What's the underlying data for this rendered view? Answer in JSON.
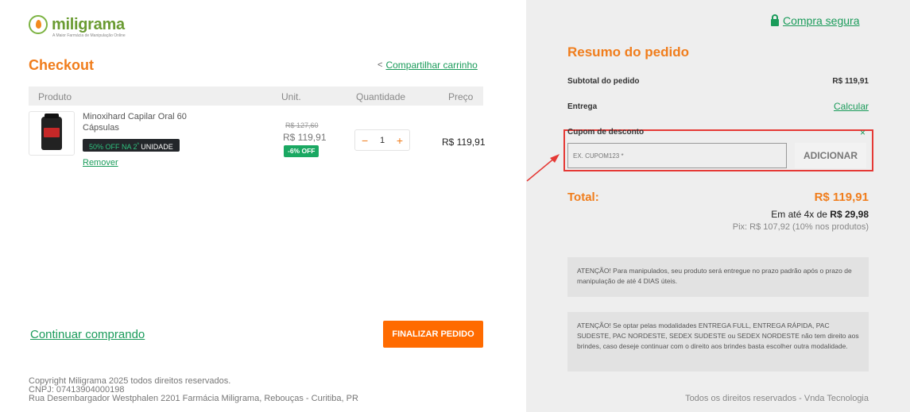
{
  "brand": {
    "name": "miligrama",
    "tagline": "A Maior Farmácia de Manipulação Online",
    "accent": "#f07d1c",
    "green": "#1a9b5a"
  },
  "checkout": {
    "title": "Checkout",
    "share_label": "Compartilhar carrinho"
  },
  "table": {
    "headers": [
      "Produto",
      "Unit.",
      "Quantidade",
      "Preço"
    ]
  },
  "item": {
    "name": "Minoxihard Capilar Oral 60 Cápsulas",
    "promo_prefix": "50% OFF NA 2",
    "promo_sup": "ª",
    "promo_suffix": " UNIDADE",
    "remove_label": "Remover",
    "old_price": "R$ 127,60",
    "unit_price": "R$ 119,91",
    "discount": "-6% OFF",
    "qty_minus": "−",
    "quantity": "1",
    "qty_plus": "+",
    "line_price": "R$ 119,91"
  },
  "actions": {
    "continue_label": "Continuar comprando",
    "finalize_label": "FINALIZAR PEDIDO"
  },
  "footer": {
    "copyright": "Copyright Miligrama 2025 todos direitos reservados.",
    "cnpj": "CNPJ: 07413904000198",
    "address": "Rua Desembargador Westphalen 2201 Farmácia Miligrama, Rebouças - Curitiba, PR",
    "rights": "Todos os direitos reservados - Vnda Tecnologia"
  },
  "summary": {
    "secure_label": "Compra segura",
    "title": "Resumo do pedido",
    "subtotal_label": "Subtotal do pedido",
    "subtotal_value": "R$ 119,91",
    "delivery_label": "Entrega",
    "delivery_action": "Calcular",
    "coupon_label": "Cupom de desconto",
    "coupon_close": "×",
    "coupon_placeholder": "EX. CUPOM123 *",
    "coupon_button": "ADICIONAR",
    "total_label": "Total:",
    "total_value": "R$ 119,91",
    "installments_prefix": "Em até 4x de ",
    "installments_value": "R$ 29,98",
    "pix": "Pix: R$ 107,92 (10% nos produtos)",
    "notice_1": "ATENÇÃO! Para manipulados, seu produto será entregue no prazo padrão após o prazo de manipulação de até 4 DIAS úteis.",
    "notice_2": "ATENÇÃO! Se optar pelas modalidades ENTREGA FULL, ENTREGA RÁPIDA, PAC SUDESTE, PAC NORDESTE, SEDEX SUDESTE ou SEDEX NORDESTE não tem direito aos brindes, caso deseje continuar com o direito aos brindes basta escolher outra modalidade."
  }
}
